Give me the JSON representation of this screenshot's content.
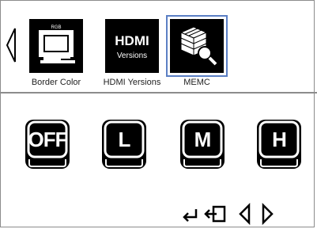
{
  "menu": {
    "items": [
      {
        "label": "Border Color",
        "icon": "rgb-monitor-icon",
        "badge": "RGB"
      },
      {
        "label": "HDMI Yersions",
        "icon": "hdmi-versions-icon",
        "badge_top": "HDMI",
        "badge_bottom": "Versions"
      },
      {
        "label": "MEMC",
        "icon": "memc-cube-icon",
        "selected": true
      }
    ]
  },
  "options": [
    "OFF",
    "L",
    "M",
    "H"
  ],
  "colors": {
    "border": "#8c8c8c",
    "selection": "#5b7fc4",
    "tile": "#000000"
  }
}
